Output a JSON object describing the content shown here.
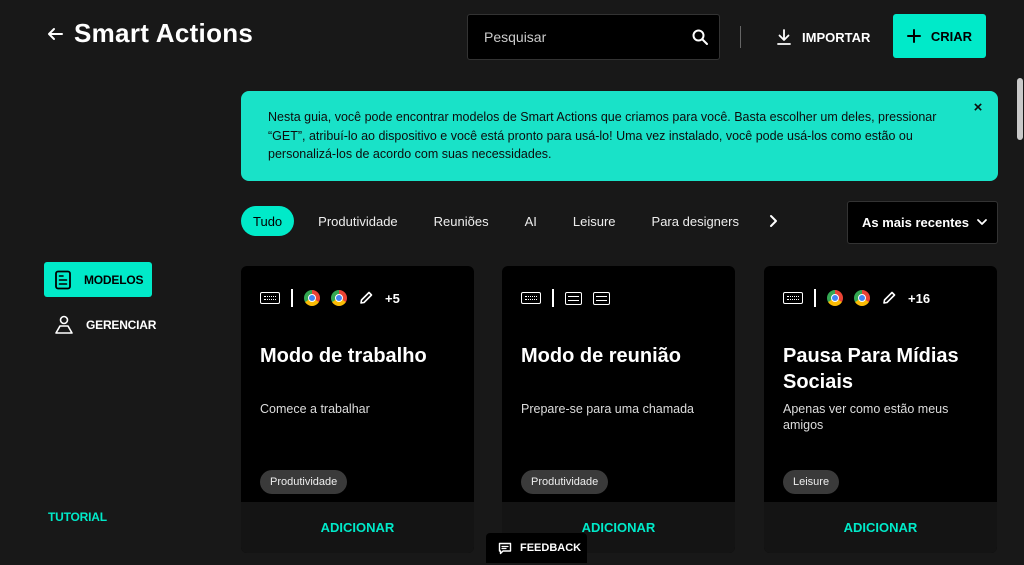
{
  "header": {
    "title": "Smart Actions",
    "search_placeholder": "Pesquisar",
    "import_label": "IMPORTAR",
    "create_label": "CRIAR"
  },
  "banner": {
    "text": "Nesta guia, você pode encontrar modelos de Smart Actions que criamos para você. Basta escolher um deles, pressionar “GET”, atribuí-lo ao dispositivo e você está pronto para usá-lo! Uma vez instalado, você pode usá-los como estão ou personalizá-los de acordo com suas necessidades.",
    "close": "×"
  },
  "filters": [
    "Tudo",
    "Produtividade",
    "Reuniões",
    "AI",
    "Leisure",
    "Para designers"
  ],
  "sort": {
    "selected": "As mais recentes"
  },
  "sidebar": {
    "models": "MODELOS",
    "manage": "GERENCIAR",
    "tutorial": "TUTORIAL"
  },
  "cards": [
    {
      "icons": [
        "keyboard-icon",
        "separator",
        "chrome-icon",
        "chrome-icon",
        "pencil-icon"
      ],
      "more": "+5",
      "title": "Modo de trabalho",
      "desc": "Comece a trabalhar",
      "tag": "Produtividade",
      "add": "ADICIONAR"
    },
    {
      "icons": [
        "keyboard-icon",
        "separator",
        "window-icon",
        "window-icon"
      ],
      "more": "",
      "title": "Modo de reunião",
      "desc": "Prepare-se para uma chamada",
      "tag": "Produtividade",
      "add": "ADICIONAR"
    },
    {
      "icons": [
        "keyboard-icon",
        "separator",
        "chrome-icon",
        "chrome-icon",
        "pencil-icon"
      ],
      "more": "+16",
      "title": "Pausa Para Mídias Sociais",
      "desc": "Apenas ver como estão meus amigos",
      "tag": "Leisure",
      "add": "ADICIONAR"
    }
  ],
  "feedback": "FEEDBACK",
  "colors": {
    "accent": "#00eac9",
    "banner": "#19e2c8",
    "background": "#181818",
    "card": "#000000"
  }
}
